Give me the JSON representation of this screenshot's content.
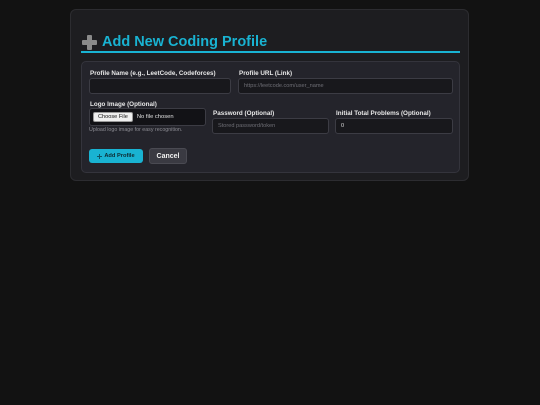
{
  "form": {
    "title": "Add New Coding Profile",
    "fields": {
      "profile_name_label": "Profile Name (e.g., LeetCode, Codeforces)",
      "profile_name_value": "",
      "profile_url_label": "Profile URL (Link)",
      "profile_url_placeholder": "https://leetcode.com/user_name",
      "logo_label": "Logo Image (Optional)",
      "logo_button": "Choose File",
      "logo_status": "No file chosen",
      "logo_hint": "Upload logo image for easy recognition.",
      "password_label": "Password (Optional)",
      "password_placeholder": "Stored password/token",
      "problems_label": "Initial Total Problems (Optional)",
      "problems_value": "0"
    },
    "buttons": {
      "add_label": "Add Profile",
      "cancel_label": "Cancel"
    },
    "colors": {
      "accent": "#19b3d2",
      "background": "#121212",
      "card": "#1d1d20"
    }
  }
}
